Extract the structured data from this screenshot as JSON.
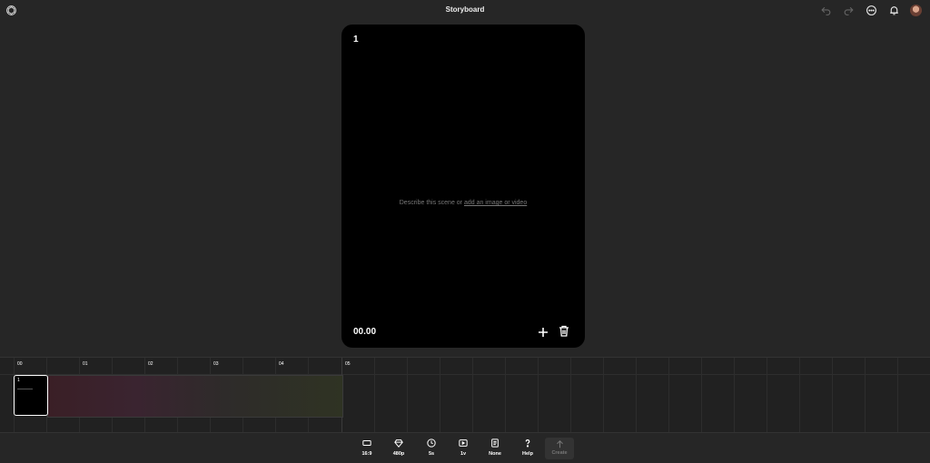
{
  "header": {
    "title": "Storyboard"
  },
  "card": {
    "number": "1",
    "prompt_text": "Describe this scene or ",
    "prompt_link": "add an image or video",
    "time": "00.00"
  },
  "timeline": {
    "ticks": [
      "00",
      "01",
      "02",
      "03",
      "04",
      "05"
    ],
    "clip_label": "1"
  },
  "toolbar": {
    "aspect": "16:9",
    "resolution": "480p",
    "duration": "5s",
    "variations": "1v",
    "preset": "None",
    "help": "Help",
    "create": "Create"
  }
}
